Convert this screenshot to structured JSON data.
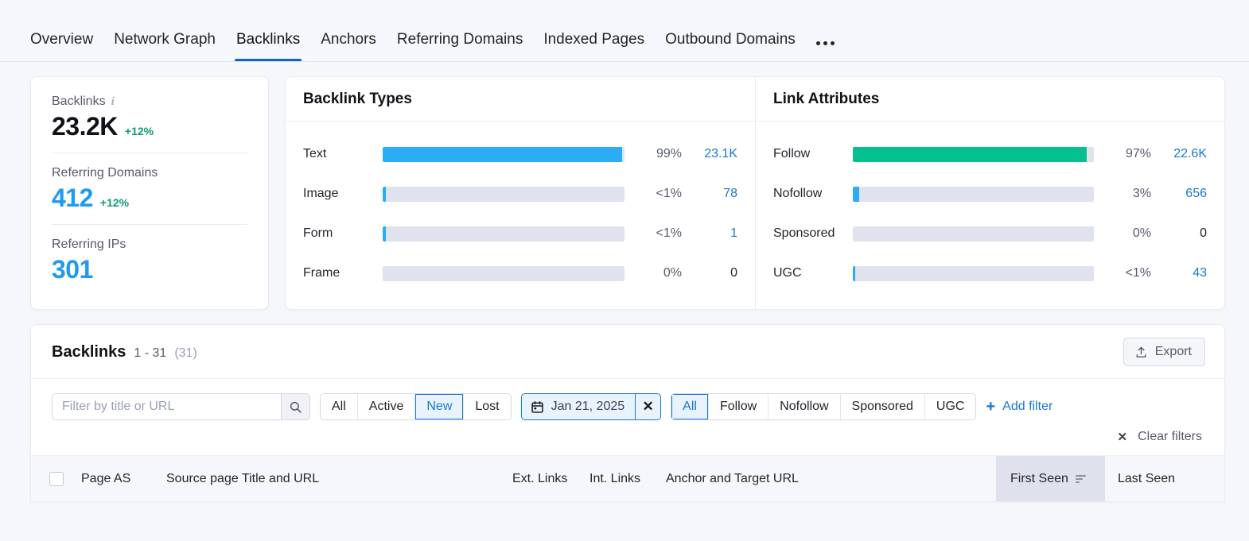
{
  "tabs": [
    {
      "label": "Overview",
      "active": false
    },
    {
      "label": "Network Graph",
      "active": false
    },
    {
      "label": "Backlinks",
      "active": true
    },
    {
      "label": "Anchors",
      "active": false
    },
    {
      "label": "Referring Domains",
      "active": false
    },
    {
      "label": "Indexed Pages",
      "active": false
    },
    {
      "label": "Outbound Domains",
      "active": false
    }
  ],
  "tabs_overflow_icon": "ellipsis-icon",
  "stats": {
    "backlinks": {
      "label": "Backlinks",
      "value": "23.2K",
      "delta": "+12%",
      "info_icon": "info-icon"
    },
    "referring_domains": {
      "label": "Referring Domains",
      "value": "412",
      "delta": "+12%"
    },
    "referring_ips": {
      "label": "Referring IPs",
      "value": "301",
      "delta": ""
    }
  },
  "backlink_types": {
    "title": "Backlink Types",
    "rows": [
      {
        "name": "Text",
        "pct_label": "99%",
        "pct": 99,
        "count": "23.1K",
        "color": "blue"
      },
      {
        "name": "Image",
        "pct_label": "<1%",
        "pct": 1.5,
        "count": "78",
        "color": "blue"
      },
      {
        "name": "Form",
        "pct_label": "<1%",
        "pct": 1.5,
        "count": "1",
        "color": "blue"
      },
      {
        "name": "Frame",
        "pct_label": "0%",
        "pct": 0,
        "count": "0",
        "color": "blue"
      }
    ]
  },
  "link_attributes": {
    "title": "Link Attributes",
    "rows": [
      {
        "name": "Follow",
        "pct_label": "97%",
        "pct": 97,
        "count": "22.6K",
        "color": "green"
      },
      {
        "name": "Nofollow",
        "pct_label": "3%",
        "pct": 3,
        "count": "656",
        "color": "blue"
      },
      {
        "name": "Sponsored",
        "pct_label": "0%",
        "pct": 0,
        "count": "0",
        "color": "blue"
      },
      {
        "name": "UGC",
        "pct_label": "<1%",
        "pct": 1.2,
        "count": "43",
        "color": "blue"
      }
    ]
  },
  "chart_data": [
    {
      "type": "bar",
      "title": "Backlink Types",
      "orientation": "horizontal",
      "categories": [
        "Text",
        "Image",
        "Form",
        "Frame"
      ],
      "values": [
        23100,
        78,
        1,
        0
      ],
      "percent_labels": [
        "99%",
        "<1%",
        "<1%",
        "0%"
      ],
      "percent_values": [
        99,
        0.3,
        0.004,
        0
      ],
      "xlabel": "",
      "ylabel": "",
      "xlim": [
        0,
        100
      ],
      "grid": false,
      "legend": "none"
    },
    {
      "type": "bar",
      "title": "Link Attributes",
      "orientation": "horizontal",
      "categories": [
        "Follow",
        "Nofollow",
        "Sponsored",
        "UGC"
      ],
      "values": [
        22600,
        656,
        0,
        43
      ],
      "percent_labels": [
        "97%",
        "3%",
        "0%",
        "<1%"
      ],
      "percent_values": [
        97,
        3,
        0,
        0.2
      ],
      "xlabel": "",
      "ylabel": "",
      "xlim": [
        0,
        100
      ],
      "grid": false,
      "legend": "none"
    }
  ],
  "table_section": {
    "title": "Backlinks",
    "range": "1 - 31",
    "total": "(31)",
    "export_label": "Export",
    "export_icon": "export-upload-icon"
  },
  "filters": {
    "search_placeholder": "Filter by title or URL",
    "search_value": "",
    "search_icon": "search-icon",
    "status_segments": [
      {
        "label": "All",
        "selected": false
      },
      {
        "label": "Active",
        "selected": false
      },
      {
        "label": "New",
        "selected": true
      },
      {
        "label": "Lost",
        "selected": false
      }
    ],
    "date_chip": {
      "label": "Jan 21, 2025",
      "calendar_icon": "calendar-icon",
      "clear_icon": "close-icon"
    },
    "attribute_segments": [
      {
        "label": "All",
        "selected": true
      },
      {
        "label": "Follow",
        "selected": false
      },
      {
        "label": "Nofollow",
        "selected": false
      },
      {
        "label": "Sponsored",
        "selected": false
      },
      {
        "label": "UGC",
        "selected": false
      }
    ],
    "add_filter_label": "Add filter",
    "add_filter_icon": "plus-icon",
    "clear_filters_label": "Clear filters",
    "clear_filters_icon": "close-icon"
  },
  "table_columns": {
    "page_as": "Page AS",
    "source": "Source page Title and URL",
    "ext_links": "Ext. Links",
    "int_links": "Int. Links",
    "anchor": "Anchor and Target URL",
    "first_seen": "First Seen",
    "last_seen": "Last Seen",
    "sort_icon": "sort-descending-icon",
    "select_all_icon": "checkbox-icon"
  },
  "colors": {
    "accent_blue": "#1877d2",
    "bar_blue": "#2bacf5",
    "bar_green": "#04c08f",
    "bar_track": "#e0e2ee",
    "value_blue": "#1e9bf0",
    "delta_green": "#0f9b72",
    "page_bg": "#f5f7fa"
  }
}
